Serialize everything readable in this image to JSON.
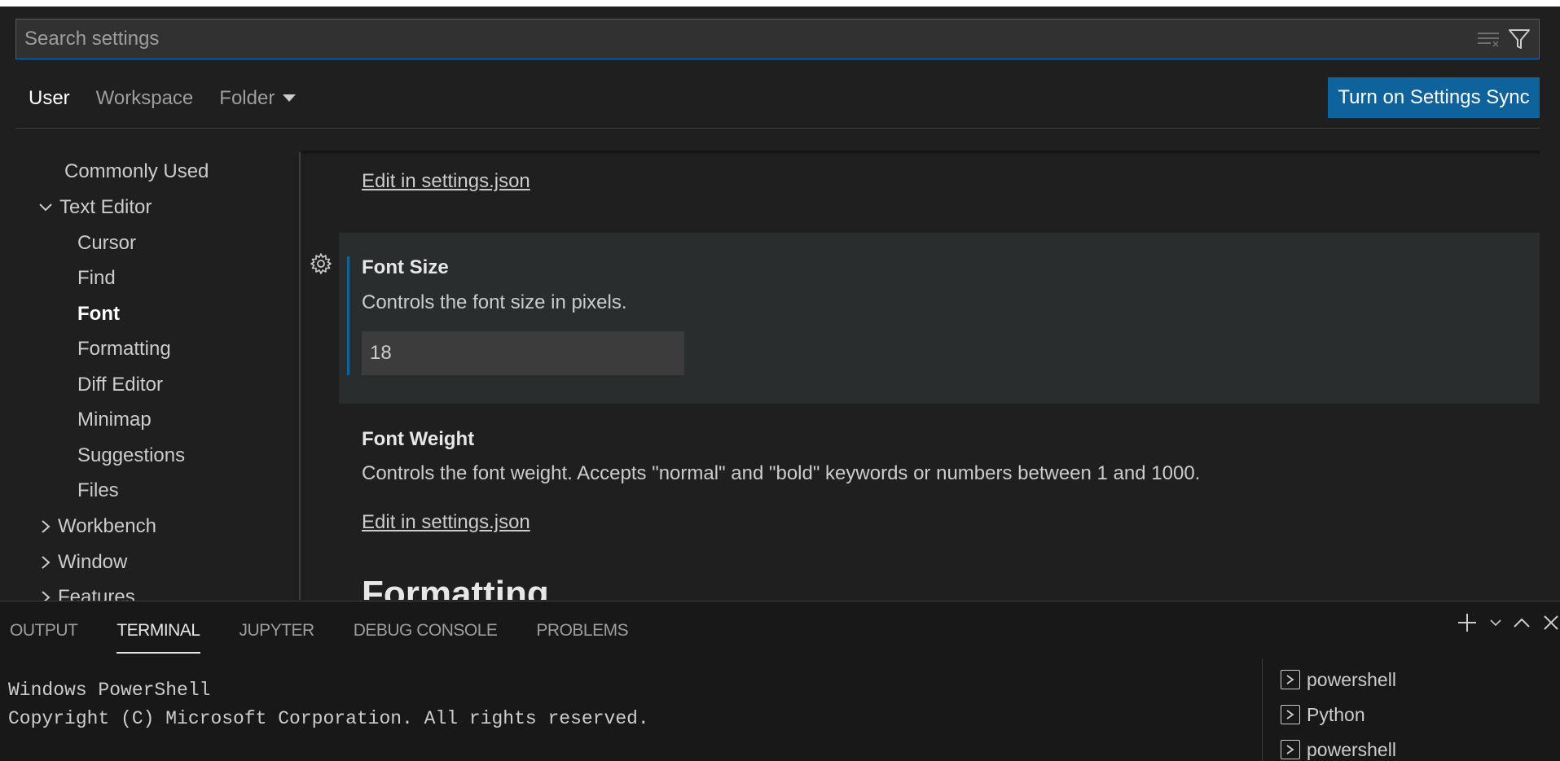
{
  "search": {
    "placeholder": "Search settings"
  },
  "scopes": {
    "user": "User",
    "workspace": "Workspace",
    "folder": "Folder"
  },
  "sync_button": "Turn on Settings Sync",
  "toc": {
    "commonly_used": "Commonly Used",
    "text_editor": "Text Editor",
    "cursor": "Cursor",
    "find": "Find",
    "font": "Font",
    "formatting": "Formatting",
    "diff_editor": "Diff Editor",
    "minimap": "Minimap",
    "suggestions": "Suggestions",
    "files": "Files",
    "workbench": "Workbench",
    "window": "Window",
    "features": "Features"
  },
  "content": {
    "edit_link_top": "Edit in settings.json",
    "font_size": {
      "title": "Font Size",
      "description": "Controls the font size in pixels.",
      "value": "18"
    },
    "font_weight": {
      "title": "Font Weight",
      "description": "Controls the font weight. Accepts \"normal\" and \"bold\" keywords or numbers between 1 and 1000.",
      "edit_link": "Edit in settings.json"
    },
    "next_section": "Formatting"
  },
  "panel": {
    "tabs": {
      "output": "OUTPUT",
      "terminal": "TERMINAL",
      "jupyter": "JUPYTER",
      "debug_console": "DEBUG CONSOLE",
      "problems": "PROBLEMS"
    },
    "terminal_lines": {
      "line1": "Windows PowerShell",
      "line2": "Copyright (C) Microsoft Corporation. All rights reserved."
    },
    "terminals": {
      "t1": "powershell",
      "t2": "Python",
      "t3": "powershell"
    }
  },
  "colors": {
    "accent": "#0e639c",
    "focus_border": "#0e70c0",
    "background": "#1f1f1f"
  }
}
